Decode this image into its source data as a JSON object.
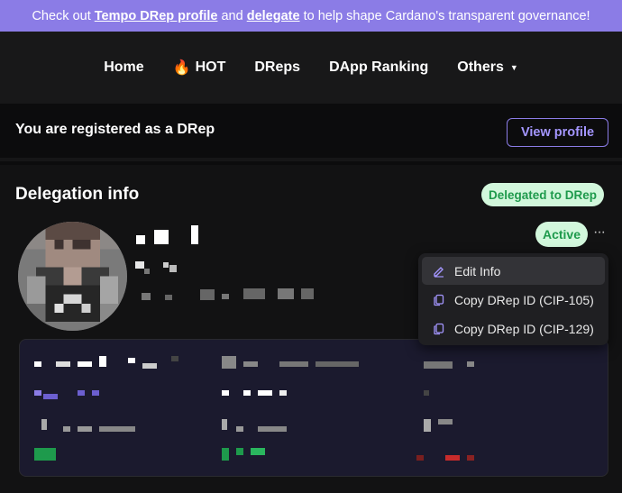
{
  "banner": {
    "prefix": "Check out ",
    "link_profile": "Tempo DRep profile",
    "middle": " and ",
    "link_delegate": "delegate",
    "suffix": " to help shape Cardano's transparent governance!"
  },
  "nav": {
    "items": [
      {
        "label": "Home"
      },
      {
        "label": "HOT",
        "icon": "fire-icon",
        "emoji": "🔥"
      },
      {
        "label": "DReps"
      },
      {
        "label": "DApp Ranking"
      },
      {
        "label": "Others",
        "icon": "chevron-down-icon",
        "glyph": "▼"
      }
    ]
  },
  "registration": {
    "text": "You are registered as a DRep",
    "button": "View profile"
  },
  "delegation": {
    "title": "Delegation info",
    "status_badge": "Delegated to DRep",
    "active_badge": "Active",
    "more_glyph": "···"
  },
  "menu": {
    "items": [
      {
        "label": "Edit Info",
        "icon": "pencil-icon"
      },
      {
        "label": "Copy DRep ID (CIP-105)",
        "icon": "copy-icon"
      },
      {
        "label": "Copy DRep ID (CIP-129)",
        "icon": "copy-icon"
      }
    ]
  },
  "colors": {
    "banner": "#8b7ce6",
    "accent": "#a496ff",
    "success_bg": "#d2f7dc",
    "success_text": "#1e9a4c"
  }
}
